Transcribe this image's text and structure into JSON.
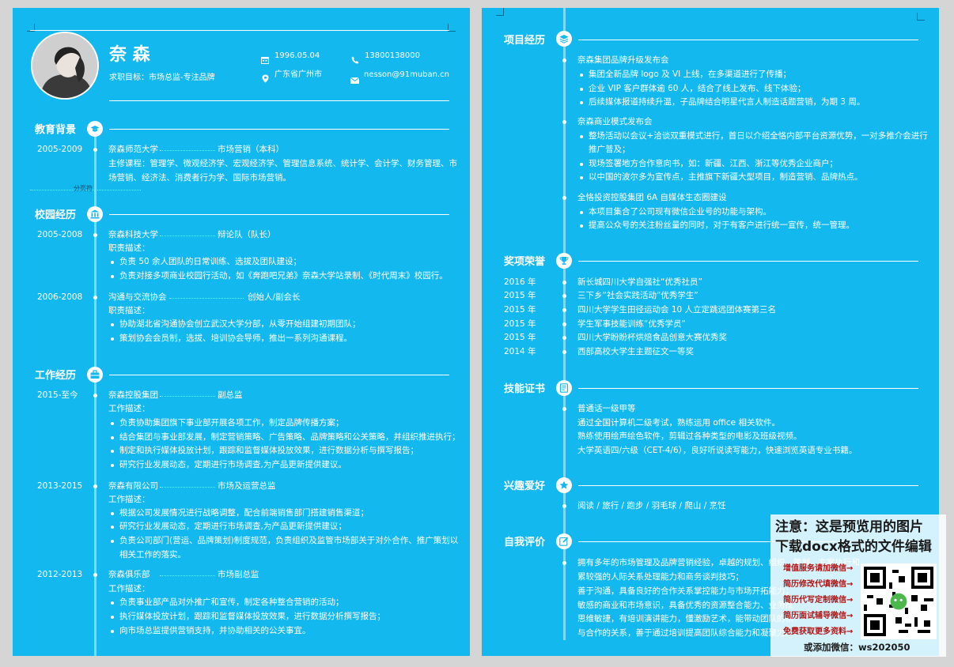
{
  "header": {
    "name": "奈 森",
    "objective": "求职目标：市场总监-专注品牌",
    "birth": "1996.05.04",
    "phone": "13800138000",
    "location": "广东省广州市",
    "email": "nesson@91muban.cn"
  },
  "page_break_label": "分页符",
  "sections": {
    "education": "教育背景",
    "campus": "校园经历",
    "work": "工作经历",
    "projects": "项目经历",
    "awards": "奖项荣誉",
    "skills": "技能证书",
    "hobbies": "兴趣爱好",
    "self": "自我评价"
  },
  "education": {
    "period": "2005-2009",
    "school": "奈森师范大学",
    "major": "市场营销（本科）",
    "courses_1": "主修课程：管理学、微观经济学、宏观经济学、管理信息系统、统计学、会计学、财务管理、市",
    "courses_2": "场营销、经济法、消费者行为学、国际市场营销。"
  },
  "campus": [
    {
      "period": "2005-2008",
      "org": "奈森科技大学",
      "role": "辩论队（队长）",
      "label": "职责描述：",
      "items": [
        "负责 50 余人团队的日常训练、选拔及团队建设；",
        "负责对接多项商业校园行活动，如《奔跑吧兄弟》奈森大学站录制、《时代周末》校园行。"
      ]
    },
    {
      "period": "2006-2008",
      "org": "沟通与交流协会",
      "role": "创始人/副会长",
      "label": "职责描述：",
      "items": [
        "协助湖北省沟通协会创立武汉大学分部，从零开始组建初期团队；",
        "策划协会会员制，选拔、培训协会导师，推出一系列沟通课程。"
      ]
    }
  ],
  "work": [
    {
      "period": "2015-至今",
      "org": "奈森控股集团",
      "role": "副总监",
      "label": "工作描述：",
      "items": [
        "负责协助集团旗下事业部开展各项工作，制定品牌传播方案；",
        "结合集团与事业部发展，制定营销策略、广告策略、品牌策略和公关策略，并组织推进执行；",
        "制定和执行媒体投放计划，跟踪和监督媒体投放效果，进行数据分析与撰写报告；",
        "研究行业发展动态，定期进行市场调查,为产品更新提供建议。"
      ]
    },
    {
      "period": "2013-2015",
      "org": "奈森有限公司",
      "role": "市场及运营总监",
      "label": "工作描述：",
      "items": [
        "根据公司发展情况进行战略调整，配合前端销售部门搭建销售渠道；",
        "研究行业发展动态，定期进行市场调查,为产品更新提供建议；",
        "负责公司部门(营运、品牌策划)制度规范，负责组织及监管市场部关于对外合作、推广策划以",
        "相关工作的落实。"
      ]
    },
    {
      "period": "2012-2013",
      "org": "奈森俱乐部",
      "role": "市场副总监",
      "label": "工作描述：",
      "items": [
        "负责事业部产品对外推广和宣传，制定各种整合营销的活动；",
        "执行媒体投放计划，跟踪和监督媒体投放效果，进行数据分析撰写报告；",
        "向市场总监提供营销支持，并协助相关的公关事宜。"
      ]
    }
  ],
  "projects": [
    {
      "title": "奈森集团品牌升级发布会",
      "items": [
        "集团全新品牌 logo 及 VI 上线，在多渠道进行了传播；",
        "企业 VIP 客户群体逾 60 人，结合了线上发布、线下体验；",
        "后续媒体报道持续升温，子品牌结合明星代言人制造话题营销，为期 3 周。"
      ]
    },
    {
      "title": "奈森商业模式发布会",
      "items": [
        "整场活动以会议+洽谈双重模式进行，首日以介绍全恪内部平台资源优势，一对多推介会进行",
        "推广普及；",
        "现场签署地方合作意向书，如：新疆、江西、浙江等优秀企业商户；",
        "以中国的波尔多为宣传点，主推旗下新疆大型项目，制造营销、品牌热点。"
      ]
    },
    {
      "title": "全恪投资控股集团 6A 自媒体生态圈建设",
      "items": [
        "本项目集合了公司现有微信企业号的功能与架构。",
        "提高公众号的关注粉丝量的同时，对于有客户进行统一宣传，统一管理。"
      ]
    }
  ],
  "awards": [
    {
      "year": "2016 年",
      "text": "新长城四川大学自强社“优秀社员”"
    },
    {
      "year": "2015 年",
      "text": "三下乡”社会实践活动“优秀学生”"
    },
    {
      "year": "2015 年",
      "text": "四川大学学生田径运动会 10 人立定跳远团体赛第三名"
    },
    {
      "year": "2015 年",
      "text": "学生军事技能训练“优秀学员”"
    },
    {
      "year": "2015 年",
      "text": "四川大学盼盼杯烘焙食品创意大赛优秀奖"
    },
    {
      "year": "2014 年",
      "text": "西部高校大学生主题征文一等奖"
    }
  ],
  "skills": [
    "普通话一级甲等",
    "通过全国计算机二级考试，熟练运用 office 相关软件。",
    "熟练使用绘声绘色软件，剪辑过各种类型的电影及班级视频。",
    "大学英语四/六级（CET-4/6），良好听说读写能力，快速浏览英语专业书籍。"
  ],
  "hobbies": "阅读 / 旅行 / 跑步 / 羽毛球 / 爬山 / 烹饪",
  "self_eval": [
    "拥有多年的市场管理及品牌营销经验，卓越的规划、组织、策划、方案执行和",
    "累较强的人际关系处理能力和商务谈判技巧；",
    "善于沟通，具备良好的合作关系掌控能力与市场开拓能力；",
    "敏感的商业和市场意识，具备优秀的资源整合能力、业务推",
    "思维敏捷，有培训演讲能力，懂激励艺术，能带动团队的积",
    "与合作的关系，善于通过培训提高团队综合能力和凝聚力。"
  ],
  "watermark": {
    "note_1": "注意：这是预览用的图片",
    "note_2": "下载docx格式的文件编辑",
    "links": [
      "增值服务请加微信→",
      "简历修改代填微信→",
      "简历代写定制微信→",
      "简历面试辅导微信→",
      "免费获取更多资料→"
    ],
    "wechat": "或添加微信：ws202050"
  },
  "colors": {
    "page_bg": "#13b8ef",
    "accent": "#ffffff",
    "timeline": "#7fd8f6",
    "watermark_red": "#b01515"
  }
}
